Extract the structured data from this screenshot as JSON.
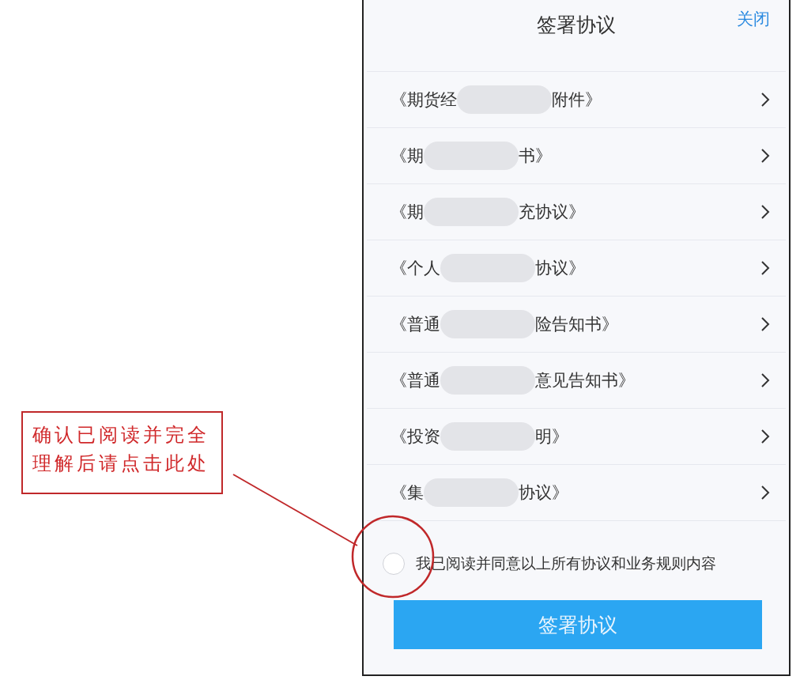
{
  "header": {
    "title": "签署协议",
    "close": "关闭"
  },
  "agreements": [
    {
      "before": "《期货经",
      "after": "附件》"
    },
    {
      "before": "《期",
      "after": "书》"
    },
    {
      "before": "《期",
      "after": "充协议》"
    },
    {
      "before": "《个人",
      "after": "协议》"
    },
    {
      "before": "《普通",
      "after": "险告知书》"
    },
    {
      "before": "《普通",
      "after": "意见告知书》"
    },
    {
      "before": "《投资",
      "after": "明》"
    },
    {
      "before": "《集",
      "after": "协议》"
    }
  ],
  "consent": {
    "label": "我已阅读并同意以上所有协议和业务规则内容",
    "checked": false
  },
  "sign_button": "签署协议",
  "callout": {
    "text": "确认已阅读并完全理解后请点击此处"
  }
}
